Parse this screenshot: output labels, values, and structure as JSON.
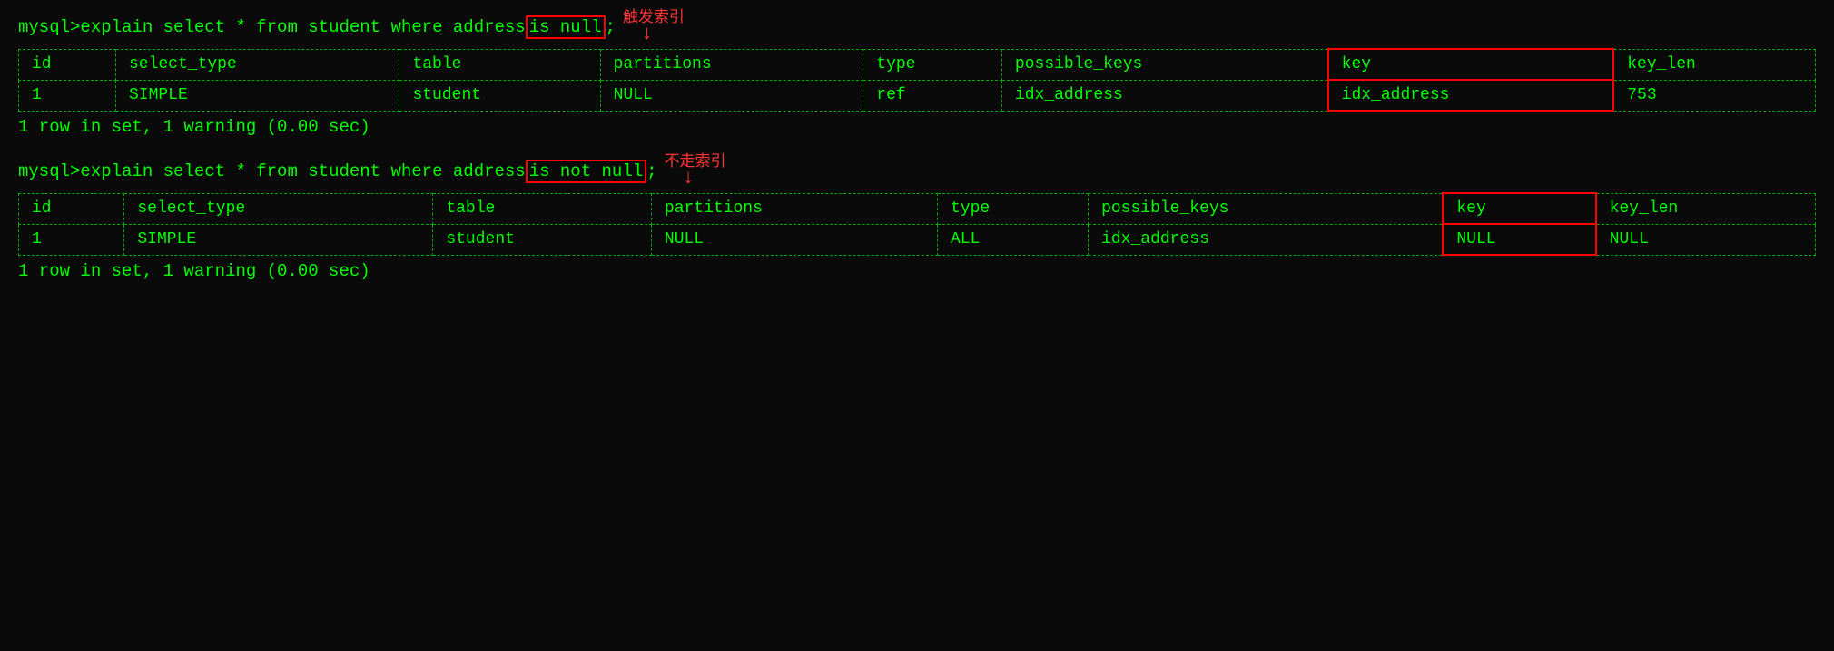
{
  "query1": {
    "prompt": "mysql>",
    "command_prefix": " explain select * from student where address ",
    "command_highlight": "is null",
    "command_suffix": ";",
    "annotation_label": "触发索引",
    "table": {
      "headers": [
        "id",
        "select_type",
        "table",
        "partitions",
        "type",
        "possible_keys",
        "key",
        "key_len"
      ],
      "rows": [
        [
          "1",
          "SIMPLE",
          "student",
          "NULL",
          "ref",
          "idx_address",
          "idx_address",
          "753"
        ]
      ],
      "key_col_index": 6
    },
    "summary": "1 row in set, 1 warning (0.00 sec)"
  },
  "query2": {
    "prompt": "mysql>",
    "command_prefix": " explain select * from student where address ",
    "command_highlight": "is not null",
    "command_suffix": ";",
    "annotation_label": "不走索引",
    "table": {
      "headers": [
        "id",
        "select_type",
        "table",
        "partitions",
        "type",
        "possible_keys",
        "key",
        "key_len"
      ],
      "rows": [
        [
          "1",
          "SIMPLE",
          "student",
          "NULL",
          "ALL",
          "idx_address",
          "NULL",
          "NULL"
        ]
      ],
      "key_col_index": 6
    },
    "summary": "1 row in set, 1 warning (0.00 sec)"
  },
  "colors": {
    "bg": "#0a0a0a",
    "text": "#00ff00",
    "border": "#00aa00",
    "highlight_border": "#ff0000",
    "annotation": "#ff3333"
  }
}
